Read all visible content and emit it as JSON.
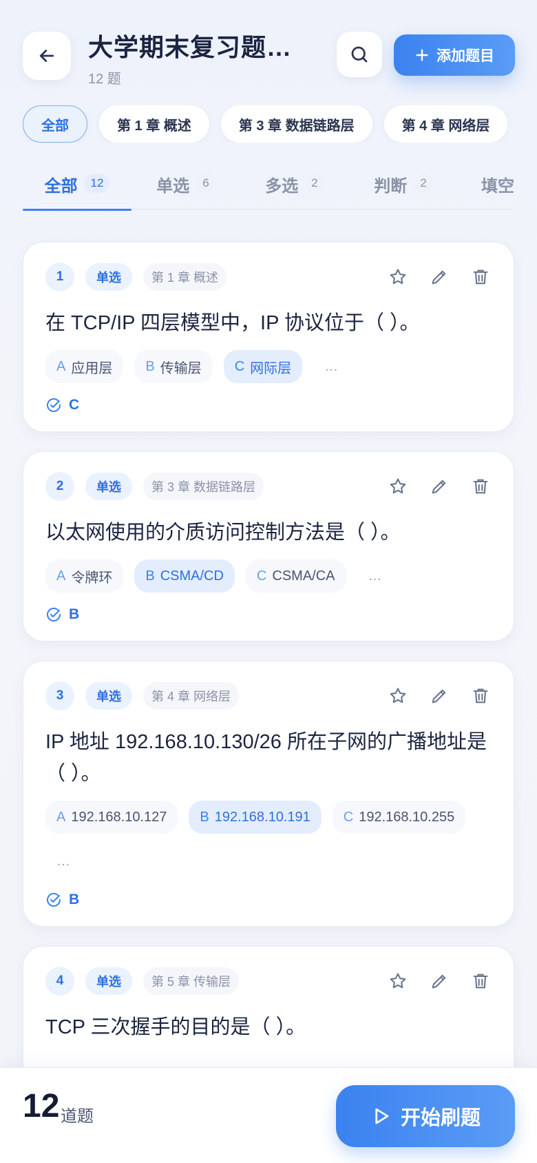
{
  "header": {
    "title": "大学期末复习题库…",
    "subtitle": "12 题",
    "add_label": "添加题目"
  },
  "chapters": [
    "全部",
    "第 1 章 概述",
    "第 3 章 数据链路层",
    "第 4 章 网络层"
  ],
  "tabs": [
    {
      "label": "全部",
      "count": "12"
    },
    {
      "label": "单选",
      "count": "6"
    },
    {
      "label": "多选",
      "count": "2"
    },
    {
      "label": "判断",
      "count": "2"
    },
    {
      "label": "填空",
      "count": ""
    }
  ],
  "questions": [
    {
      "num": "1",
      "type": "单选",
      "chapter": "第 1 章 概述",
      "text": "在 TCP/IP 四层模型中，IP 协议位于（ ）。",
      "options": [
        {
          "key": "A",
          "text": "应用层"
        },
        {
          "key": "B",
          "text": "传输层"
        },
        {
          "key": "C",
          "text": "网际层"
        }
      ],
      "more": "…",
      "answer": "C"
    },
    {
      "num": "2",
      "type": "单选",
      "chapter": "第 3 章 数据链路层",
      "text": "以太网使用的介质访问控制方法是（ ）。",
      "options": [
        {
          "key": "A",
          "text": "令牌环"
        },
        {
          "key": "B",
          "text": "CSMA/CD"
        },
        {
          "key": "C",
          "text": "CSMA/CA"
        }
      ],
      "more": "…",
      "answer": "B"
    },
    {
      "num": "3",
      "type": "单选",
      "chapter": "第 4 章 网络层",
      "text": "IP 地址 192.168.10.130/26 所在子网的广播地址是（ ）。",
      "options": [
        {
          "key": "A",
          "text": "192.168.10.127"
        },
        {
          "key": "B",
          "text": "192.168.10.191"
        },
        {
          "key": "C",
          "text": "192.168.10.255"
        }
      ],
      "more": "…",
      "answer": "B"
    },
    {
      "num": "4",
      "type": "单选",
      "chapter": "第 5 章 传输层",
      "text": "TCP 三次握手的目的是（ ）。"
    }
  ],
  "footer": {
    "count": "12",
    "unit": "道题",
    "start_label": "开始刷题"
  },
  "colors": {
    "accent": "#3b82f0",
    "accent_light": "#eaf2fe"
  }
}
